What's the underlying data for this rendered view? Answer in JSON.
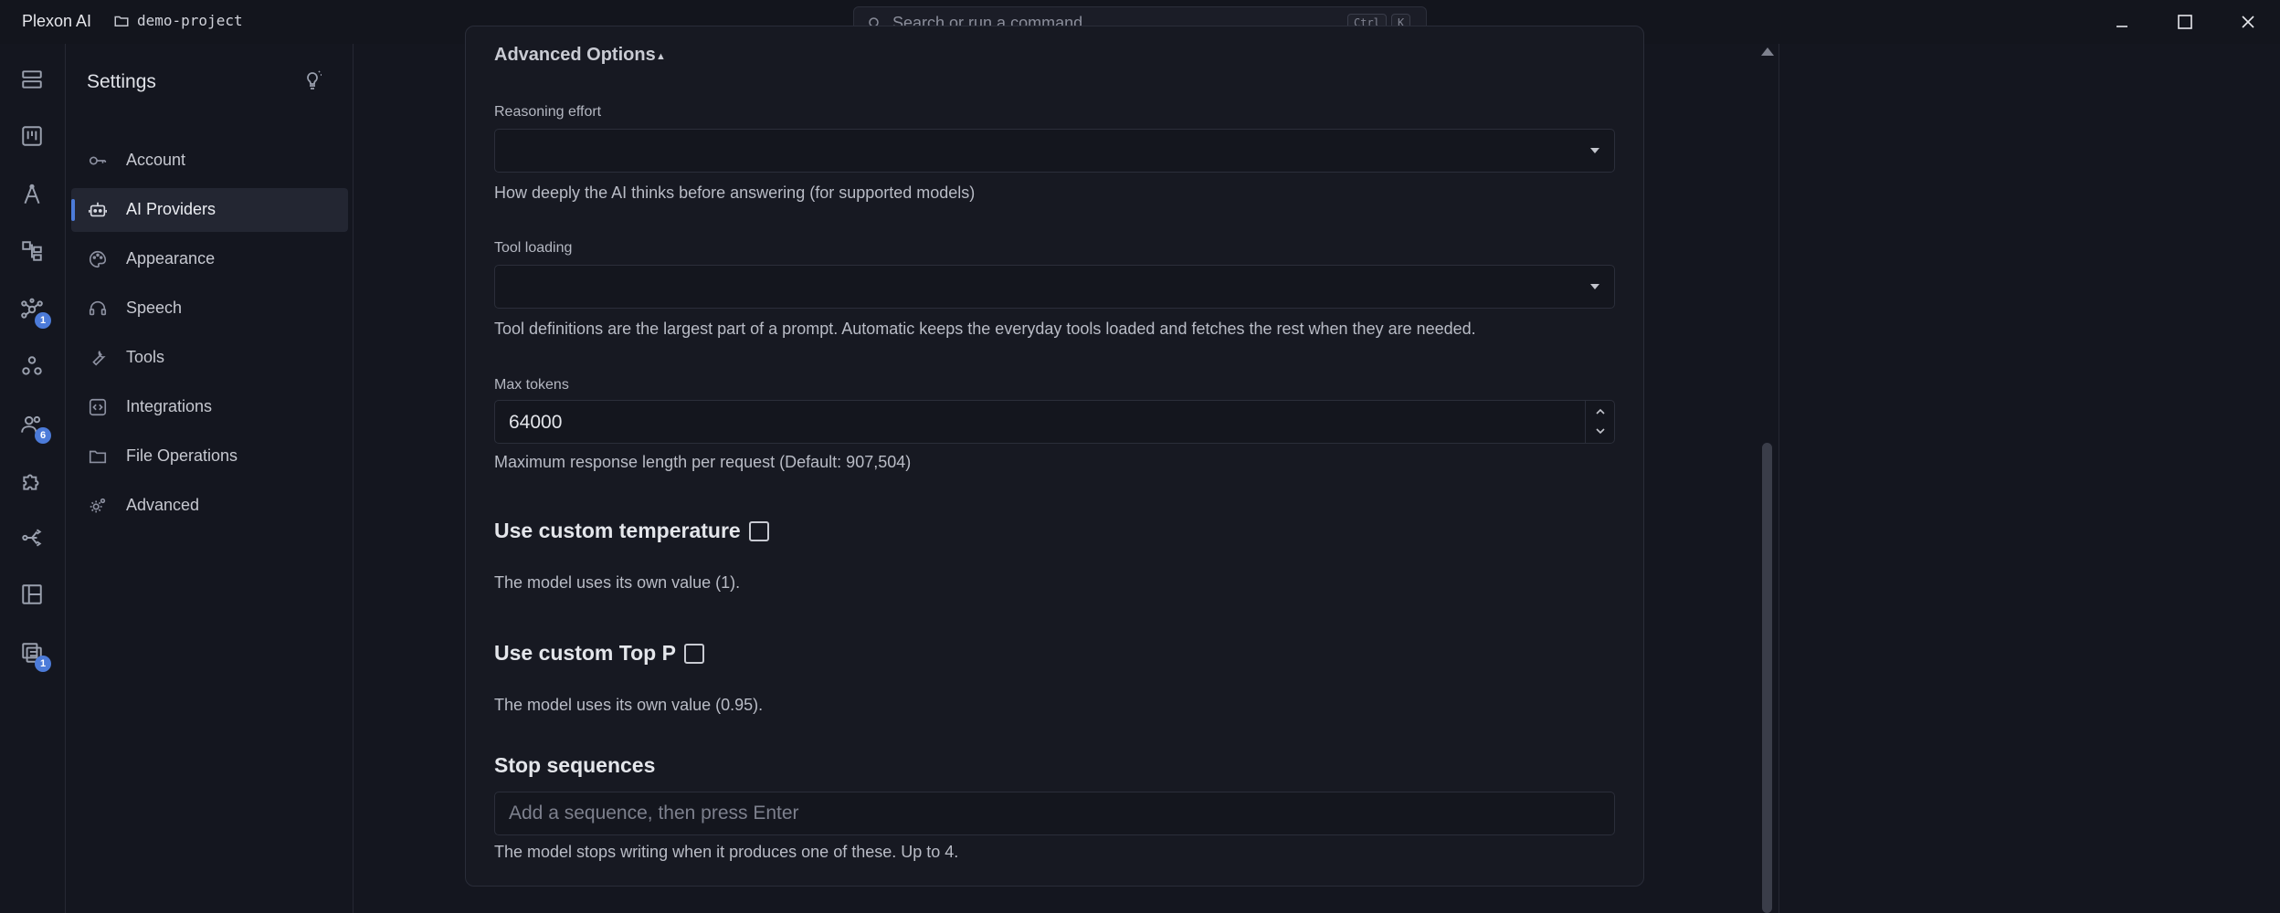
{
  "titlebar": {
    "app_title": "Plexon AI",
    "project": "demo-project",
    "search_placeholder": "Search or run a command",
    "shortcut_ctrl": "Ctrl",
    "shortcut_key": "K"
  },
  "activity": {
    "badges": {
      "agents": "1",
      "team": "6",
      "tasks": "1"
    }
  },
  "settings": {
    "title": "Settings",
    "nav": [
      {
        "label": "Account",
        "icon": "key-icon"
      },
      {
        "label": "AI Providers",
        "icon": "robot-icon",
        "active": true
      },
      {
        "label": "Appearance",
        "icon": "palette-icon"
      },
      {
        "label": "Speech",
        "icon": "headset-icon"
      },
      {
        "label": "Tools",
        "icon": "wrench-icon"
      },
      {
        "label": "Integrations",
        "icon": "plug-icon"
      },
      {
        "label": "File Operations",
        "icon": "folder-icon"
      },
      {
        "label": "Advanced",
        "icon": "gears-icon"
      }
    ]
  },
  "advanced": {
    "title": "Advanced Options",
    "reasoning_label": "Reasoning effort",
    "reasoning_help": "How deeply the AI thinks before answering (for supported models)",
    "tool_loading_label": "Tool loading",
    "tool_loading_help": "Tool definitions are the largest part of a prompt. Automatic keeps the everyday tools loaded and fetches the rest when they are needed.",
    "max_tokens_label": "Max tokens",
    "max_tokens_value": "64000",
    "max_tokens_help": "Maximum response length per request (Default: 907,504)",
    "temperature_title": "Use custom temperature",
    "temperature_help": "The model uses its own value (1).",
    "top_p_title": "Use custom Top P",
    "top_p_help": "The model uses its own value (0.95).",
    "stop_title": "Stop sequences",
    "stop_placeholder": "Add a sequence, then press Enter",
    "stop_help": "The model stops writing when it produces one of these. Up to 4."
  },
  "colors": {
    "accent": "#4c7bd9",
    "background": "#14161f",
    "panel": "#171922"
  }
}
